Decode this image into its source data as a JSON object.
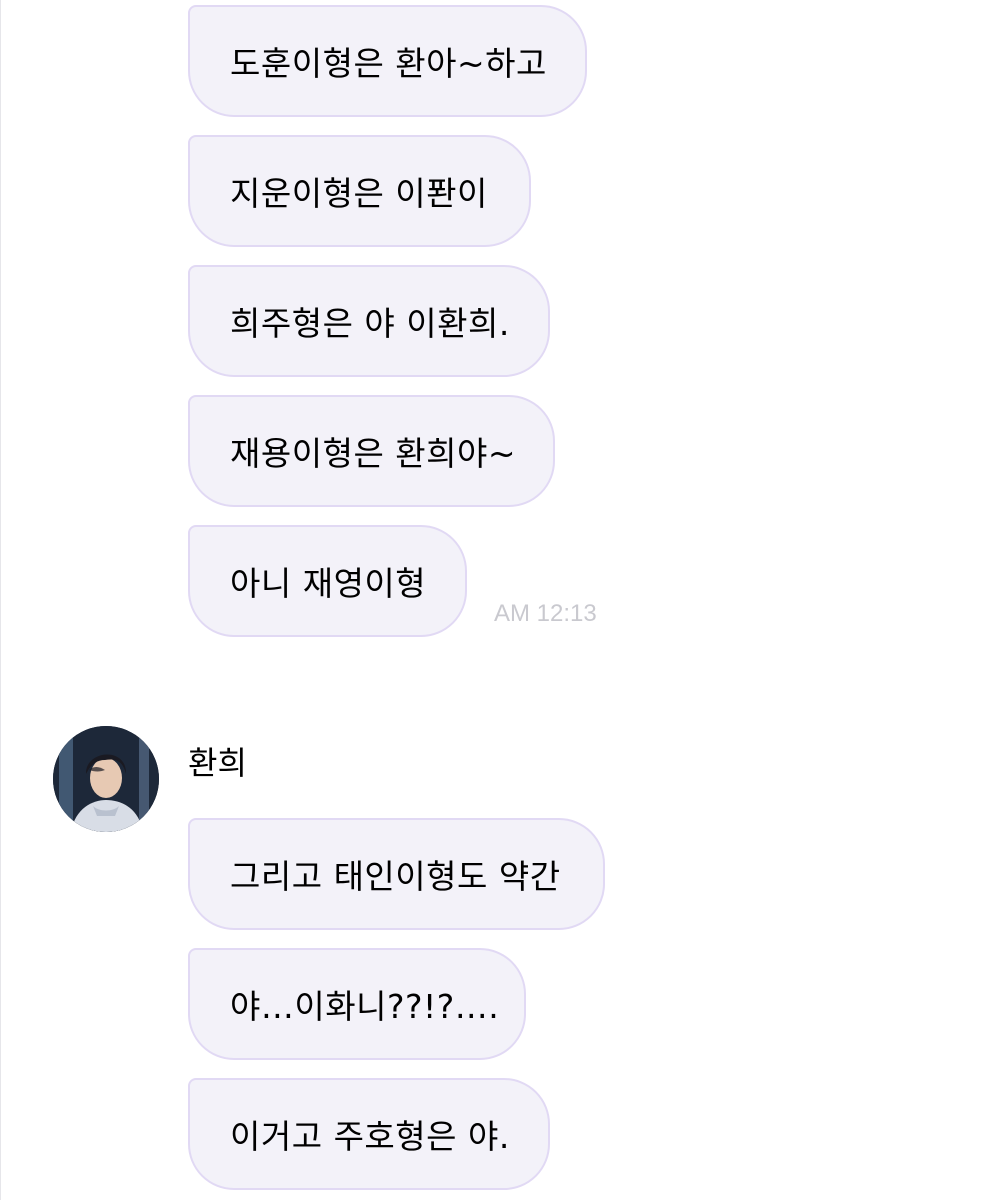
{
  "chat": {
    "messages_block_1": [
      {
        "text": "도훈이형은 환아~하고"
      },
      {
        "text": "지운이형은 이퐌이"
      },
      {
        "text": "희주형은 야 이환희."
      },
      {
        "text": "재용이형은 환희야~"
      },
      {
        "text": "아니 재영이형"
      }
    ],
    "block_1_time": "AM 12:13",
    "sender": {
      "name": "환희",
      "avatar_icon": "profile-photo"
    },
    "messages_block_2": [
      {
        "text": "그리고 태인이형도 약간"
      },
      {
        "text": "야…이화니??!?…."
      },
      {
        "text": "이거고 주호형은 야."
      }
    ]
  },
  "colors": {
    "bubble_bg": "#f3f2f9",
    "bubble_border": "#e1d9f4",
    "timestamp": "#c9c9cf"
  }
}
